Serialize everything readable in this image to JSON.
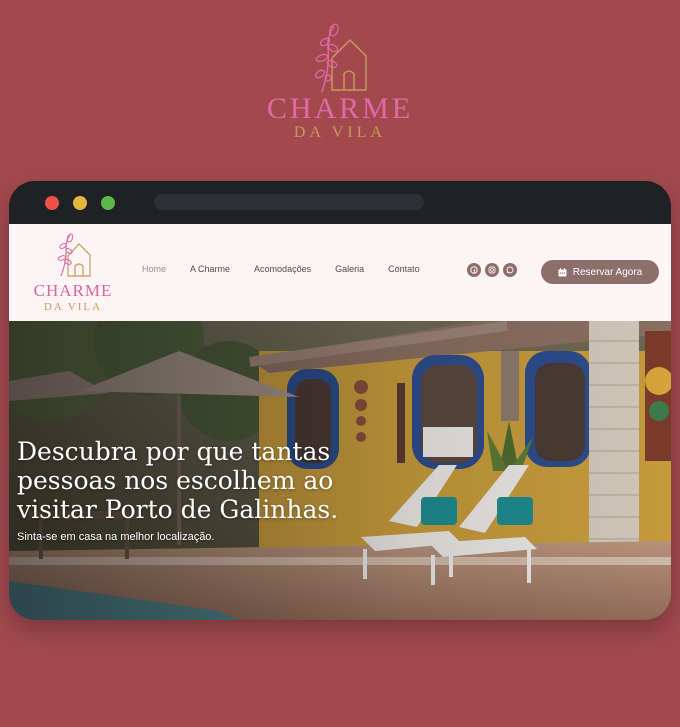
{
  "brand": {
    "title": "CHARME",
    "subtitle": "DA VILA"
  },
  "window": {
    "controls": [
      "close",
      "minimize",
      "maximize"
    ]
  },
  "site": {
    "logo_title": "CHARME",
    "logo_subtitle": "DA VILA",
    "nav": {
      "home": "Home",
      "about": "A Charme",
      "rooms": "Acomodações",
      "gallery": "Galeria",
      "contact": "Contato"
    },
    "social_icons": [
      "facebook-icon",
      "instagram-icon",
      "whatsapp-icon"
    ],
    "reserve_label": "Reservar Agora"
  },
  "hero": {
    "title_line1": "Descubra por que tantas",
    "title_line2": "pessoas nos escolhem ao",
    "title_line3": "visitar Porto de Galinhas.",
    "subtitle": "Sinta-se em casa na melhor localização."
  },
  "colors": {
    "background": "#a3494e",
    "brand_pink": "#e06aa8",
    "brand_gold": "#c79a5c",
    "button": "#8c6f6a"
  }
}
